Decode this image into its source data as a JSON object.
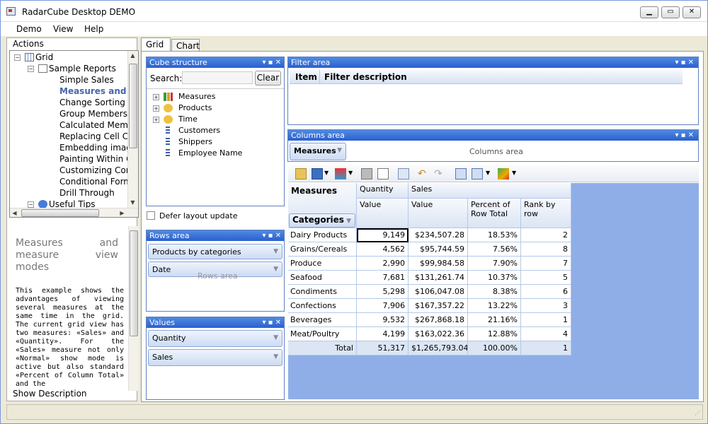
{
  "window": {
    "title": "RadarCube Desktop DEMO"
  },
  "menu": [
    "Demo",
    "View",
    "Help"
  ],
  "left": {
    "actions_label": "Actions",
    "show_description": "Show Description"
  },
  "tree": [
    {
      "label": "Grid",
      "level": 0,
      "bold": false
    },
    {
      "label": "Sample Reports",
      "level": 1,
      "bold": false
    },
    {
      "label": "Simple Sales",
      "level": 2,
      "bold": false
    },
    {
      "label": "Measures and me",
      "level": 2,
      "bold": true
    },
    {
      "label": "Change Sorting Orde",
      "level": 2,
      "bold": false
    },
    {
      "label": "Group Members",
      "level": 2,
      "bold": false
    },
    {
      "label": "Calculated Members",
      "level": 2,
      "bold": false
    },
    {
      "label": "Replacing Cell Conte",
      "level": 2,
      "bold": false
    },
    {
      "label": "Embedding images ir",
      "level": 2,
      "bold": false
    },
    {
      "label": "Painting Within Cells",
      "level": 2,
      "bold": false
    },
    {
      "label": "Customizing Context",
      "level": 2,
      "bold": false
    },
    {
      "label": "Conditional Formattir",
      "level": 2,
      "bold": false
    },
    {
      "label": "Drill Through",
      "level": 2,
      "bold": false
    },
    {
      "label": "Useful Tips",
      "level": 1,
      "bold": false
    }
  ],
  "description": {
    "heading": "Measures and measure view modes",
    "body": "This example shows the advantages of viewing several measures at the same time in the grid. The current grid view has two measures: «Sales» and «Quantity». For the «Sales» measure not only «Normal» show mode is active but also standard «Percent of Column Total» and the"
  },
  "tabs": [
    "Grid",
    "Chart"
  ],
  "cube": {
    "title": "Cube structure",
    "search_label": "Search:",
    "clear": "Clear",
    "items": [
      "Measures",
      "Products",
      "Time",
      "Customers",
      "Shippers",
      "Employee Name"
    ],
    "defer": "Defer layout update"
  },
  "rows_area": {
    "title": "Rows area",
    "items": [
      "Products by categories",
      "Date"
    ],
    "watermark": "Rows area"
  },
  "values_area": {
    "title": "Values",
    "items": [
      "Quantity",
      "Sales"
    ]
  },
  "filter": {
    "title": "Filter area",
    "col_item": "Item",
    "col_desc": "Filter description"
  },
  "columns_area": {
    "title": "Columns area",
    "pill": "Measures",
    "placeholder": "Columns area"
  },
  "grid": {
    "measures_label": "Measures",
    "categories_label": "Categories",
    "top_headers": [
      "Quantity",
      "Sales"
    ],
    "sub_headers": [
      "Value",
      "Value",
      "Percent of Row Total",
      "Rank by row"
    ],
    "rows": [
      {
        "cat": "Dairy Products",
        "q": "9,149",
        "s": "$234,507.28",
        "p": "18.53%",
        "r": "2"
      },
      {
        "cat": "Grains/Cereals",
        "q": "4,562",
        "s": "$95,744.59",
        "p": "7.56%",
        "r": "8"
      },
      {
        "cat": "Produce",
        "q": "2,990",
        "s": "$99,984.58",
        "p": "7.90%",
        "r": "7"
      },
      {
        "cat": "Seafood",
        "q": "7,681",
        "s": "$131,261.74",
        "p": "10.37%",
        "r": "5"
      },
      {
        "cat": "Condiments",
        "q": "5,298",
        "s": "$106,047.08",
        "p": "8.38%",
        "r": "6"
      },
      {
        "cat": "Confections",
        "q": "7,906",
        "s": "$167,357.22",
        "p": "13.22%",
        "r": "3"
      },
      {
        "cat": "Beverages",
        "q": "9,532",
        "s": "$267,868.18",
        "p": "21.16%",
        "r": "1"
      },
      {
        "cat": "Meat/Poultry",
        "q": "4,199",
        "s": "$163,022.36",
        "p": "12.88%",
        "r": "4"
      }
    ],
    "total": {
      "cat": "Total",
      "q": "51,317",
      "s": "$1,265,793.04",
      "p": "100.00%",
      "r": "1"
    }
  },
  "colors": {
    "accent": "#2b5fd1",
    "grid_bg": "#8faee8",
    "header": "#dbe5f4"
  }
}
